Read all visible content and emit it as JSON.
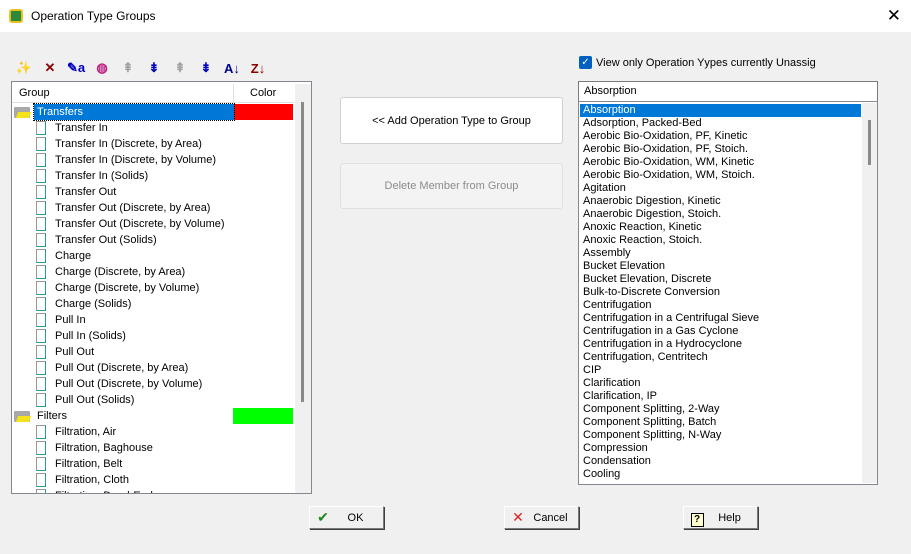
{
  "window": {
    "title": "Operation Type Groups"
  },
  "toolbar": [
    {
      "name": "new-group-wand-icon",
      "glyph": "✨"
    },
    {
      "name": "delete-icon",
      "glyph": "✕",
      "color": "#8b0000"
    },
    {
      "name": "rename-icon",
      "glyph": "✎a",
      "color": "#0000c0"
    },
    {
      "name": "color-wheel-icon",
      "glyph": "◍",
      "color": "#c02080"
    },
    {
      "name": "move-up-icon",
      "glyph": "⇞",
      "color": "#a0a0a0"
    },
    {
      "name": "move-down-icon",
      "glyph": "⇟",
      "color": "#0000c0"
    },
    {
      "name": "move-top-icon",
      "glyph": "⇞",
      "color": "#a0a0a0"
    },
    {
      "name": "move-bottom-icon",
      "glyph": "⇟",
      "color": "#0000c0"
    },
    {
      "name": "sort-az-icon",
      "glyph": "A↓",
      "color": "#00008b"
    },
    {
      "name": "sort-za-icon",
      "glyph": "Z↓",
      "color": "#8b0000"
    }
  ],
  "tree": {
    "headers": {
      "group": "Group",
      "color": "Color"
    },
    "rows": [
      {
        "type": "group",
        "label": "Transfers",
        "color": "#ff0000",
        "selected": true
      },
      {
        "type": "leaf",
        "label": "Transfer In"
      },
      {
        "type": "leaf",
        "label": "Transfer In (Discrete, by Area)"
      },
      {
        "type": "leaf",
        "label": "Transfer In (Discrete, by Volume)"
      },
      {
        "type": "leaf",
        "label": "Transfer In (Solids)"
      },
      {
        "type": "leaf",
        "label": "Transfer Out"
      },
      {
        "type": "leaf",
        "label": "Transfer Out (Discrete, by Area)"
      },
      {
        "type": "leaf",
        "label": "Transfer Out (Discrete, by Volume)"
      },
      {
        "type": "leaf",
        "label": "Transfer Out (Solids)"
      },
      {
        "type": "leaf",
        "label": "Charge"
      },
      {
        "type": "leaf",
        "label": "Charge (Discrete, by Area)"
      },
      {
        "type": "leaf",
        "label": "Charge (Discrete, by Volume)"
      },
      {
        "type": "leaf",
        "label": "Charge (Solids)"
      },
      {
        "type": "leaf",
        "label": "Pull In"
      },
      {
        "type": "leaf",
        "label": "Pull In (Solids)"
      },
      {
        "type": "leaf",
        "label": "Pull Out"
      },
      {
        "type": "leaf",
        "label": "Pull Out (Discrete, by Area)"
      },
      {
        "type": "leaf",
        "label": "Pull Out (Discrete, by Volume)"
      },
      {
        "type": "leaf",
        "label": "Pull Out (Solids)"
      },
      {
        "type": "group",
        "label": "Filters",
        "color": "#00ff00",
        "selected": false
      },
      {
        "type": "leaf",
        "label": "Filtration, Air"
      },
      {
        "type": "leaf",
        "label": "Filtration, Baghouse"
      },
      {
        "type": "leaf",
        "label": "Filtration, Belt"
      },
      {
        "type": "leaf",
        "label": "Filtration, Cloth"
      },
      {
        "type": "leaf",
        "label": "Filtration, Dead-End"
      }
    ]
  },
  "actions": {
    "add": "<< Add Operation Type to Group",
    "delete": "Delete  Member from Group"
  },
  "filter": {
    "label": "View only Operation Yypes currently Unassig",
    "checked": true
  },
  "combo": {
    "value": "Absorption"
  },
  "list": {
    "selected": "Absorption",
    "items": [
      "Absorption",
      "Adsorption, Packed-Bed",
      "Aerobic Bio-Oxidation, PF, Kinetic",
      "Aerobic Bio-Oxidation, PF, Stoich.",
      "Aerobic Bio-Oxidation, WM, Kinetic",
      "Aerobic Bio-Oxidation, WM, Stoich.",
      "Agitation",
      "Anaerobic Digestion, Kinetic",
      "Anaerobic Digestion, Stoich.",
      "Anoxic Reaction, Kinetic",
      "Anoxic Reaction, Stoich.",
      "Assembly",
      "Bucket Elevation",
      "Bucket Elevation, Discrete",
      "Bulk-to-Discrete Conversion",
      "Centrifugation",
      "Centrifugation in a Centrifugal Sieve",
      "Centrifugation in a Gas Cyclone",
      "Centrifugation in a Hydrocyclone",
      "Centrifugation, Centritech",
      "CIP",
      "Clarification",
      "Clarification, IP",
      "Component Splitting, 2-Way",
      "Component Splitting, Batch",
      "Component Splitting, N-Way",
      "Compression",
      "Condensation",
      "Cooling"
    ]
  },
  "buttons": {
    "ok": "OK",
    "cancel": "Cancel",
    "help": "Help"
  }
}
